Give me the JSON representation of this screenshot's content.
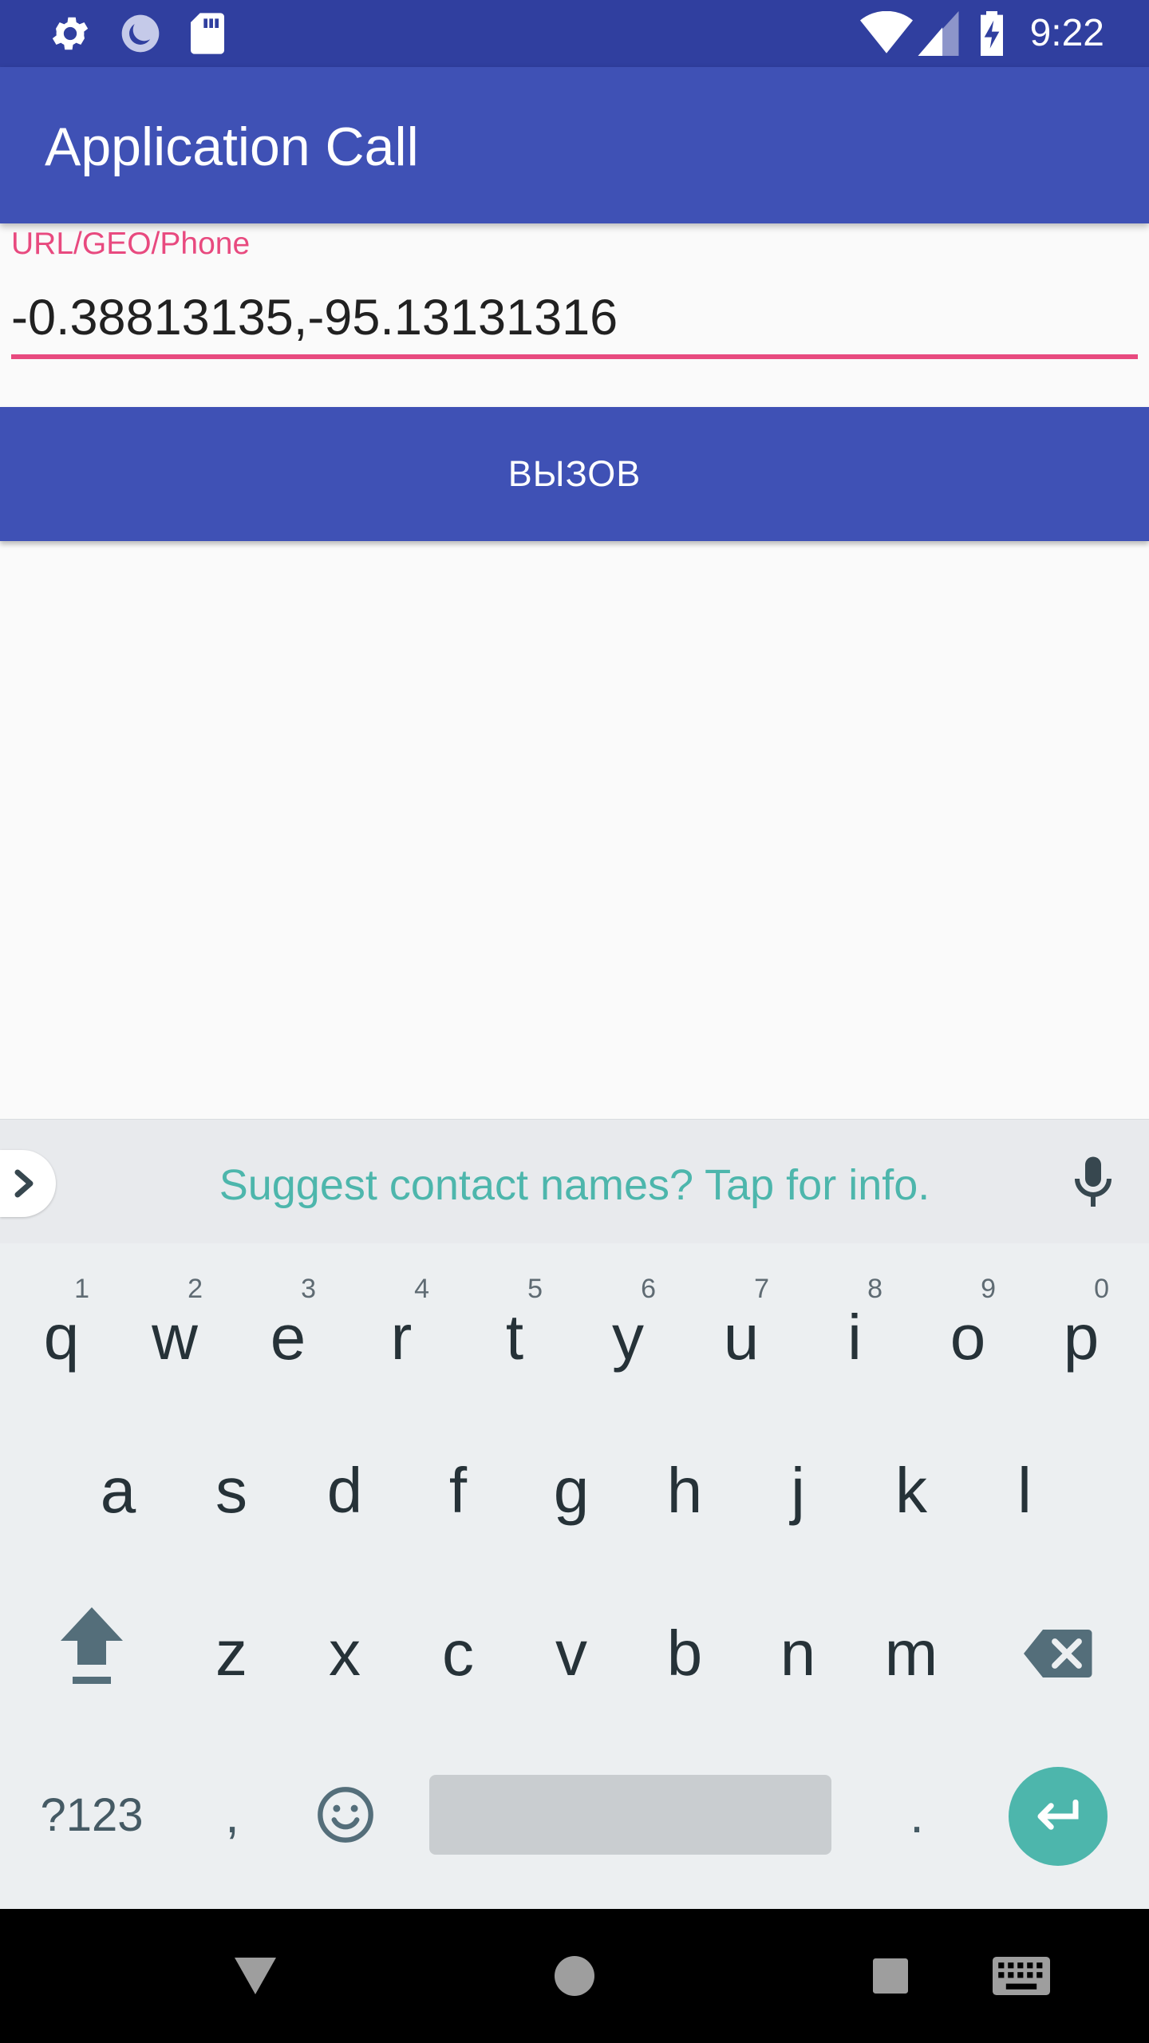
{
  "status_bar": {
    "time": "9:22",
    "icons": [
      "gear-icon",
      "sync-icon",
      "sd-card-icon",
      "wifi-icon",
      "signal-icon",
      "battery-charging-icon"
    ]
  },
  "app_bar": {
    "title": "Application Call"
  },
  "form": {
    "label": "URL/GEO/Phone",
    "value": "-0.38813135,-95.13131316",
    "accent_color": "#e84a7f"
  },
  "call_button": {
    "label": "ВЫЗОВ",
    "color": "#3f51b5"
  },
  "keyboard": {
    "suggestion": "Suggest contact names? Tap for info.",
    "row1": [
      {
        "key": "q",
        "hint": "1"
      },
      {
        "key": "w",
        "hint": "2"
      },
      {
        "key": "e",
        "hint": "3"
      },
      {
        "key": "r",
        "hint": "4"
      },
      {
        "key": "t",
        "hint": "5"
      },
      {
        "key": "y",
        "hint": "6"
      },
      {
        "key": "u",
        "hint": "7"
      },
      {
        "key": "i",
        "hint": "8"
      },
      {
        "key": "o",
        "hint": "9"
      },
      {
        "key": "p",
        "hint": "0"
      }
    ],
    "row2": [
      "a",
      "s",
      "d",
      "f",
      "g",
      "h",
      "j",
      "k",
      "l"
    ],
    "row3": [
      "z",
      "x",
      "c",
      "v",
      "b",
      "n",
      "m"
    ],
    "symbols_label": "?123",
    "comma": ",",
    "period": ".",
    "accent_color": "#4db6ac"
  },
  "nav_bar": {
    "buttons": [
      "back-icon",
      "home-icon",
      "recents-icon",
      "keyboard-switch-icon"
    ]
  }
}
